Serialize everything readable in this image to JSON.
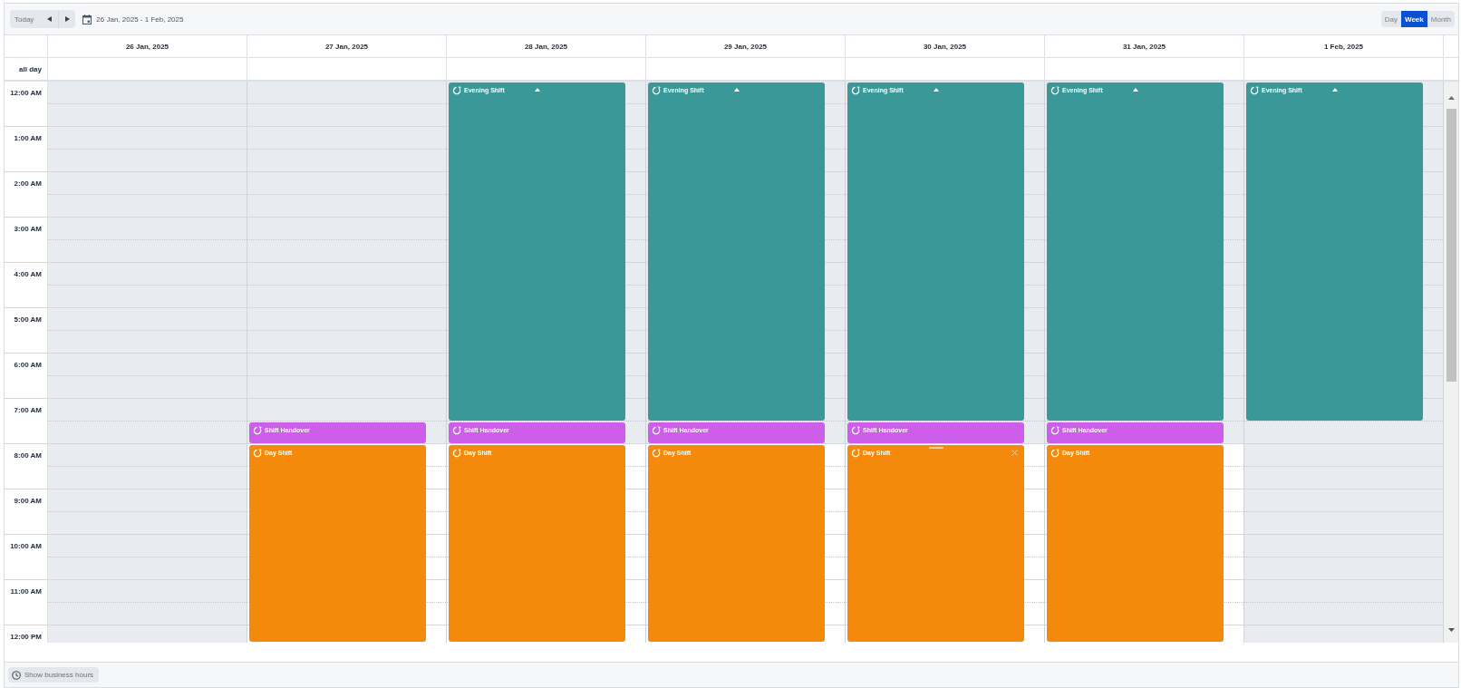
{
  "toolbar": {
    "today_button": "Today",
    "date_range": "26 Jan, 2025 - 1 Feb, 2025",
    "views": [
      {
        "label": "Day",
        "selected": false
      },
      {
        "label": "Week",
        "selected": true
      },
      {
        "label": "Month",
        "selected": false
      }
    ]
  },
  "calendar": {
    "all_day_label": "all day",
    "time_slots": [
      "12:00 AM",
      "1:00 AM",
      "2:00 AM",
      "3:00 AM",
      "4:00 AM",
      "5:00 AM",
      "6:00 AM",
      "7:00 AM",
      "8:00 AM",
      "9:00 AM",
      "10:00 AM",
      "11:00 AM",
      "12:00 PM"
    ],
    "days": [
      {
        "date": "26 Jan, 2025",
        "workday": false
      },
      {
        "date": "27 Jan, 2025",
        "workday": true,
        "events": [
          {
            "kind": "handover",
            "title": "Shift Handover",
            "color": "#cd5ee9",
            "continues_from_previous_day": false,
            "selected": false
          },
          {
            "kind": "day",
            "title": "Day Shift",
            "color": "#f5890b",
            "continues_from_previous_day": false,
            "selected": false
          }
        ]
      },
      {
        "date": "28 Jan, 2025",
        "workday": true,
        "events": [
          {
            "kind": "evening",
            "title": "Evening Shift",
            "color": "#3a9899",
            "continues_from_previous_day": true,
            "selected": false
          },
          {
            "kind": "handover",
            "title": "Shift Handover",
            "color": "#cd5ee9",
            "continues_from_previous_day": false,
            "selected": false
          },
          {
            "kind": "day",
            "title": "Day Shift",
            "color": "#f5890b",
            "continues_from_previous_day": false,
            "selected": false
          }
        ]
      },
      {
        "date": "29 Jan, 2025",
        "workday": true,
        "events": [
          {
            "kind": "evening",
            "title": "Evening Shift",
            "color": "#3a9899",
            "continues_from_previous_day": true,
            "selected": false
          },
          {
            "kind": "handover",
            "title": "Shift Handover",
            "color": "#cd5ee9",
            "continues_from_previous_day": false,
            "selected": false
          },
          {
            "kind": "day",
            "title": "Day Shift",
            "color": "#f5890b",
            "continues_from_previous_day": false,
            "selected": false
          }
        ]
      },
      {
        "date": "30 Jan, 2025",
        "workday": true,
        "events": [
          {
            "kind": "evening",
            "title": "Evening Shift",
            "color": "#3a9899",
            "continues_from_previous_day": true,
            "selected": false
          },
          {
            "kind": "handover",
            "title": "Shift Handover",
            "color": "#cd5ee9",
            "continues_from_previous_day": false,
            "selected": false
          },
          {
            "kind": "day",
            "title": "Day Shift",
            "color": "#f5890b",
            "continues_from_previous_day": false,
            "selected": true
          }
        ]
      },
      {
        "date": "31 Jan, 2025",
        "workday": true,
        "events": [
          {
            "kind": "evening",
            "title": "Evening Shift",
            "color": "#3a9899",
            "continues_from_previous_day": true,
            "selected": false
          },
          {
            "kind": "handover",
            "title": "Shift Handover",
            "color": "#cd5ee9",
            "continues_from_previous_day": false,
            "selected": false
          },
          {
            "kind": "day",
            "title": "Day Shift",
            "color": "#f5890b",
            "continues_from_previous_day": false,
            "selected": false
          }
        ]
      },
      {
        "date": "1 Feb, 2025",
        "workday": false,
        "events": [
          {
            "kind": "evening",
            "title": "Evening Shift",
            "color": "#3a9899",
            "continues_from_previous_day": true,
            "selected": false
          }
        ]
      }
    ]
  },
  "footer": {
    "business_hours_button": "Show business hours"
  }
}
